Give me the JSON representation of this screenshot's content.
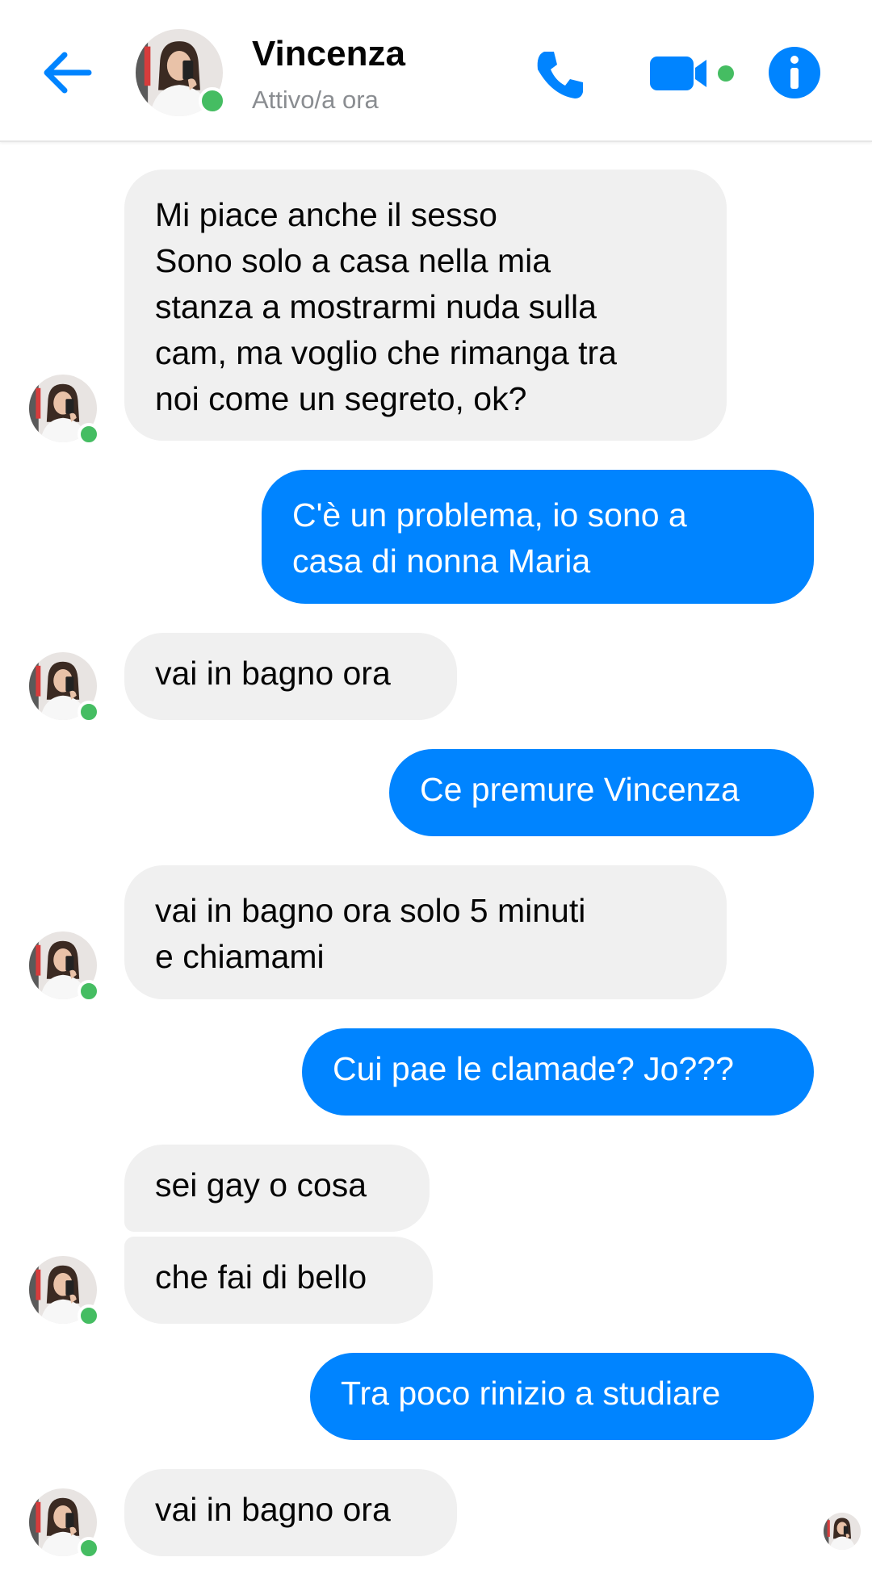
{
  "header": {
    "contact_name": "Vincenza",
    "status": "Attivo/a ora",
    "accent_color": "#0084ff",
    "online_color": "#45bd62",
    "icons": [
      "back-arrow-icon",
      "phone-icon",
      "video-camera-icon",
      "info-icon"
    ]
  },
  "messages": [
    {
      "sender": "Vincenza",
      "text": "Mi piace anche il sesso\nSono solo a casa nella mia\nstanza a mostrarmi nuda sulla\ncam, ma voglio che rimanga tra\nnoi come un segreto, ok?"
    },
    {
      "sender": "me",
      "text": "C'è un problema, io sono a\ncasa di nonna Maria"
    },
    {
      "sender": "Vincenza",
      "text": "vai in bagno ora"
    },
    {
      "sender": "me",
      "text": "Ce premure Vincenza"
    },
    {
      "sender": "Vincenza",
      "text": "vai in bagno ora solo  5 minuti\ne chiamami"
    },
    {
      "sender": "me",
      "text": "Cui pae le clamade? Jo???"
    },
    {
      "sender": "Vincenza",
      "text": "sei gay o cosa"
    },
    {
      "sender": "Vincenza",
      "text": "che fai di bello"
    },
    {
      "sender": "me",
      "text": "Tra poco rinizio a studiare"
    },
    {
      "sender": "Vincenza",
      "text": "vai in bagno ora"
    }
  ]
}
